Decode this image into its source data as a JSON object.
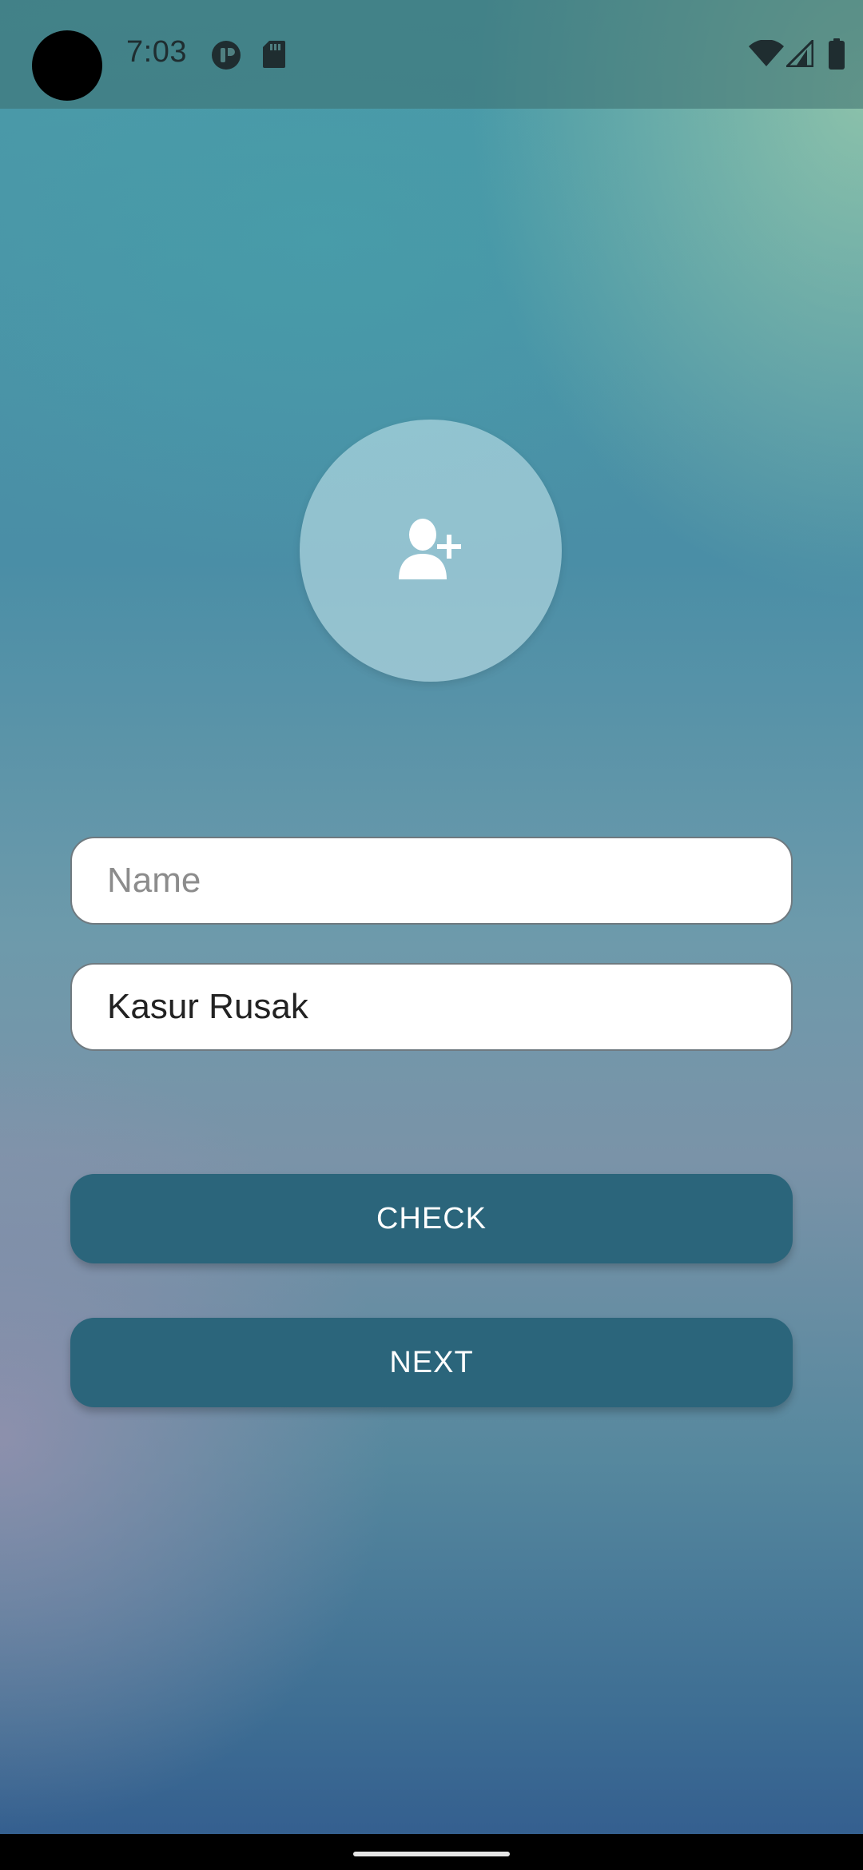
{
  "status_bar": {
    "time": "7:03",
    "icons": [
      "app-notification-icon",
      "sd-card-icon",
      "wifi-icon",
      "signal-icon",
      "battery-icon"
    ]
  },
  "avatar": {
    "icon": "add-person-icon"
  },
  "form": {
    "name_placeholder": "Name",
    "second_value": "Kasur Rusak"
  },
  "buttons": {
    "check_label": "CHECK",
    "next_label": "NEXT"
  },
  "colors": {
    "button": "#2b657b",
    "input_background": "#ffffff"
  }
}
